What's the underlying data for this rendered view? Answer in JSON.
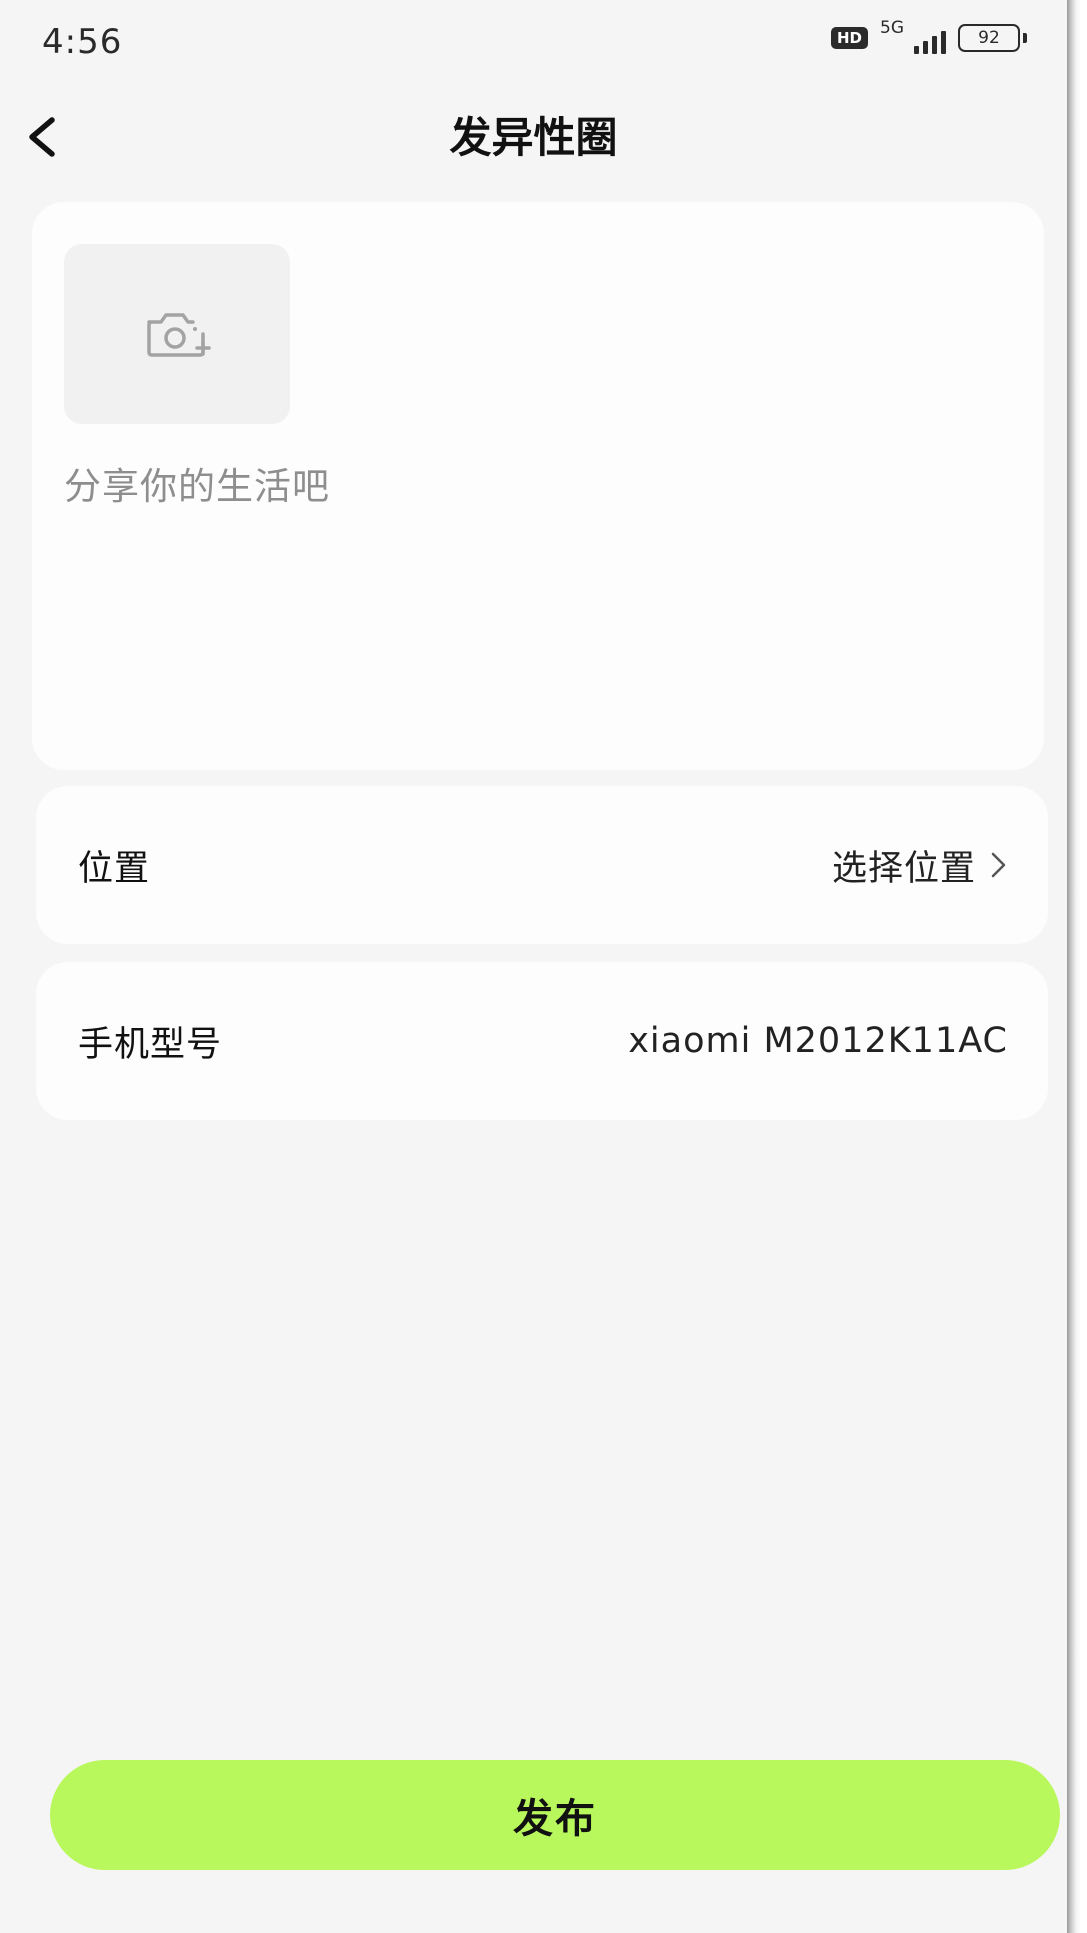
{
  "status_bar": {
    "time": "4:56",
    "hd_badge": "HD",
    "network": "5G",
    "battery": "92"
  },
  "header": {
    "title": "发异性圈",
    "back_icon": "chevron-left-icon"
  },
  "post": {
    "photo_icon": "camera-plus-icon",
    "placeholder": "分享你的生活吧",
    "text": ""
  },
  "location": {
    "label": "位置",
    "value": "选择位置",
    "icon": "chevron-right-icon"
  },
  "phone_model": {
    "label": "手机型号",
    "value": "xiaomi M2012K11AC"
  },
  "publish": {
    "label": "发布",
    "color": "#b8f85c"
  },
  "colors": {
    "page_bg": "#f5f5f5",
    "card_bg": "#fdfdfd",
    "accent": "#b8f85c"
  }
}
